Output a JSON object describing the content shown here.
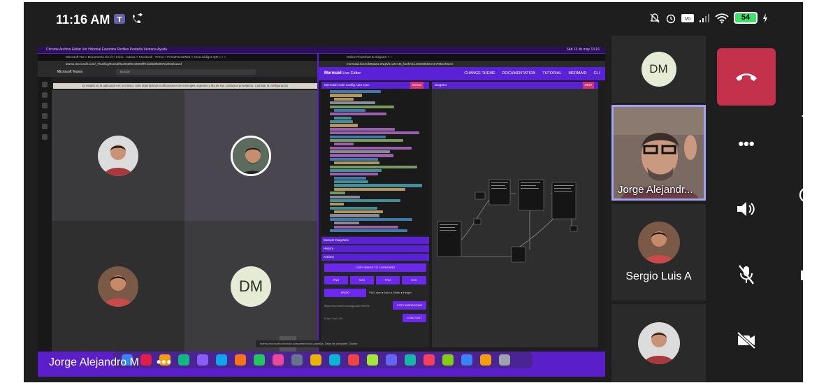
{
  "status_bar": {
    "time": "11:16 AM",
    "battery": "54"
  },
  "shared_screen": {
    "presenter_name": "Jorge Alejandro M",
    "more_label": "•••",
    "mac_menu": "Chrome   Archivo   Editar   Ver   Historial   Favoritos   Perfiles   Pestaña   Ventana   Ayuda",
    "mac_clock": "Sáb 13 de may  13:16",
    "teams": {
      "tabs": "Microsoft Tea  ×   Documento sin tít  ×   Inicio - Canva  ×   Facebook - Preso  ×   PrimeFacesWeb  ×   Crea códigos QR c  ×   +",
      "url": "teams.microsoft.com/_#/calling/9cea4f0ac063f8e43660ff91bd8d0b9870/whiteboard",
      "app_name": "Microsoft Teams",
      "search_placeholder": "Buscar",
      "banner": "El estado en la aplicación es lo mismo. Solo obtendrá las notificaciones de mensajes urgentes y las de sus contactos prioritarios. Cambiar la configuración",
      "tile_dm": "DM"
    },
    "mermaid": {
      "tabs": "Online FlowChart & Diagram  ×   +",
      "url": "mermaid.live/edit#pako:eNqtVk1v2zAM_fuXhmUuGSG8bkSm4nF0EmhSJzr",
      "logo": "Mermaid",
      "logo_suffix": "Live Editor",
      "nav": [
        "CHANGE THEME",
        "DOCUMENTATION",
        "TUTORIAL",
        "MERMAID",
        "CLI"
      ],
      "editor_tabs": "Mermaid   Code   Config     Auto sync",
      "docs": "DOCS",
      "diagram_label": "Diagram",
      "new_label": "NEW",
      "sample_diagrams": "Sample Diagrams",
      "history": "History",
      "actions": "Actions",
      "copy_image": "COPY IMAGE TO CLIPBOARD",
      "png": "PNG",
      "svg": "SVG",
      "png2": "PNG",
      "svg2": "SVG",
      "kroki": "KROKI",
      "png_size": "PNG size  ● Auto  ● Width  ● Height",
      "gist_url": "https://mermaid.ink/img/pako:eNrtVk",
      "copy_markdown": "COPY MARKDOWN",
      "gist_placeholder": "Enter Gist URL",
      "load_gist": "LOAD GIST"
    },
    "share_notice": "teams.microsoft.com está compartiendo tu pantalla.   Dejar de compartir   Ocultar"
  },
  "participants": [
    {
      "name": "DM",
      "kind": "initials"
    },
    {
      "name": "Jorge Alejandr...",
      "kind": "video",
      "active_speaker": true
    },
    {
      "name": "Sergio Luis A",
      "kind": "photo"
    },
    {
      "name": "",
      "kind": "photo"
    }
  ],
  "controls": {
    "end_call": "end-call",
    "more": "•••",
    "speaker": "speaker-on",
    "mic": "mic-muted",
    "camera": "camera-off"
  },
  "colors": {
    "end_call": "#c4314b",
    "mermaid_accent": "#5b21d6",
    "active_speaker_border": "#a3a2f0"
  }
}
